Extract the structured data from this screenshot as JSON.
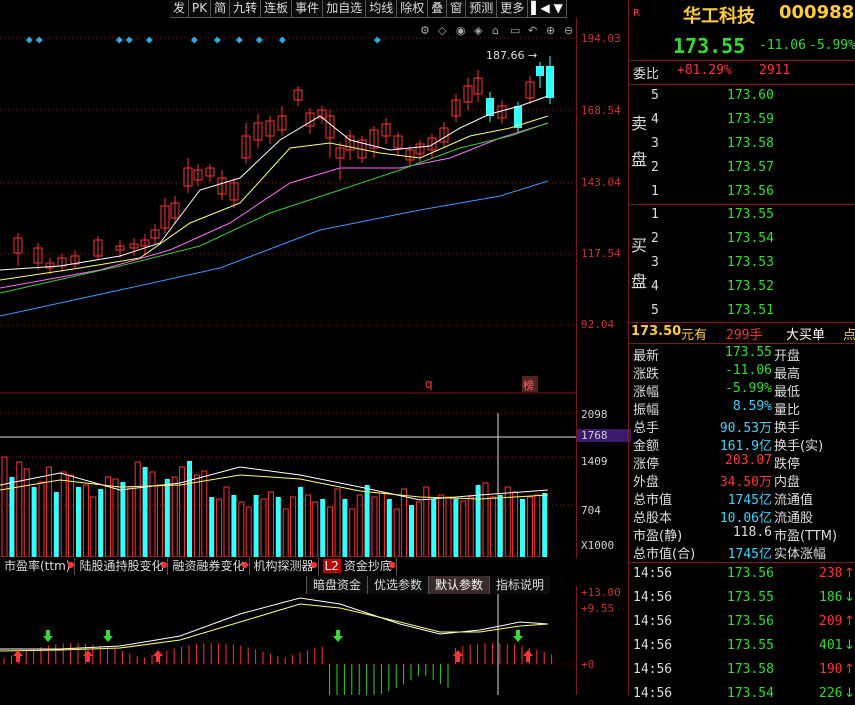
{
  "toolbar": [
    "发",
    "PK",
    "简",
    "九转",
    "连板",
    "事件",
    "加自选",
    "均线",
    "除权",
    "叠",
    "窗",
    "预测",
    "更多"
  ],
  "main_axis": [
    "194.03",
    "168.54",
    "143.04",
    "117.54",
    "92.04"
  ],
  "vol_axis": [
    "2098",
    "1768",
    "1409",
    "704",
    "X1000"
  ],
  "macd_axis": [
    "+13.00",
    "+9.55",
    "+0"
  ],
  "peak_label": "187.66",
  "bottom_marks": {
    "q": "q",
    "bang": "榜"
  },
  "indicator_tabs": [
    "市盈率(ttm)",
    "陆股通持股变化",
    "融资融券变化",
    "机构探测器",
    "资金抄底"
  ],
  "l2_badge": "L2",
  "sub_tabs": [
    "暗盘资金",
    "优选参数",
    "默认参数",
    "指标说明"
  ],
  "stock": {
    "badge": "R",
    "name": "华工科技",
    "code": "000988",
    "price": "173.55",
    "change": "-11.06",
    "pct": "-5.99%"
  },
  "weibi": {
    "label": "委比",
    "pct": "+81.29%",
    "diff": "2911"
  },
  "sell": {
    "label1": "卖",
    "label2": "盘",
    "levels": [
      {
        "n": "5",
        "p": "173.60"
      },
      {
        "n": "4",
        "p": "173.59"
      },
      {
        "n": "3",
        "p": "173.58"
      },
      {
        "n": "2",
        "p": "173.57"
      },
      {
        "n": "1",
        "p": "173.56"
      }
    ]
  },
  "buy": {
    "label1": "买",
    "label2": "盘",
    "levels": [
      {
        "n": "1",
        "p": "173.55"
      },
      {
        "n": "2",
        "p": "173.54"
      },
      {
        "n": "3",
        "p": "173.53"
      },
      {
        "n": "4",
        "p": "173.52"
      },
      {
        "n": "5",
        "p": "173.51"
      }
    ]
  },
  "bigorder": {
    "price": "173.50",
    "text1": "元有",
    "qty": "299手",
    "text2": "大买单",
    "tail": "点"
  },
  "stats": [
    {
      "l": "最新",
      "v": "173.55",
      "c": "gval",
      "l2": "开盘"
    },
    {
      "l": "涨跌",
      "v": "-11.06",
      "c": "gval",
      "l2": "最高"
    },
    {
      "l": "涨幅",
      "v": "-5.99%",
      "c": "gval",
      "l2": "最低"
    },
    {
      "l": "振幅",
      "v": "8.59%",
      "c": "cyan",
      "l2": "量比"
    },
    {
      "l": "总手",
      "v": "90.53万",
      "c": "cyan",
      "l2": "换手"
    },
    {
      "l": "金额",
      "v": "161.9亿",
      "c": "cyan",
      "l2": "换手(实)"
    },
    {
      "l": "涨停",
      "v": "203.07",
      "c": "rval",
      "l2": "跌停"
    },
    {
      "l": "外盘",
      "v": "34.50万",
      "c": "rval",
      "l2": "内盘"
    },
    {
      "l": "总市值",
      "v": "1745亿",
      "c": "cyan",
      "l2": "流通值"
    },
    {
      "l": "总股本",
      "v": "10.06亿",
      "c": "cyan",
      "l2": "流通股"
    },
    {
      "l": "市盈(静)",
      "v": "118.6",
      "c": "wval",
      "l2": "市盈(TTM)"
    },
    {
      "l": "总市值(合)",
      "v": "1745亿",
      "c": "cyan",
      "l2": "实体涨幅"
    }
  ],
  "ticks": [
    {
      "t": "14:56",
      "p": "173.56",
      "q": "238",
      "dir": "up"
    },
    {
      "t": "14:56",
      "p": "173.55",
      "q": "186",
      "dir": "down"
    },
    {
      "t": "14:56",
      "p": "173.56",
      "q": "209",
      "dir": "up"
    },
    {
      "t": "14:56",
      "p": "173.55",
      "q": "401",
      "dir": "down"
    },
    {
      "t": "14:56",
      "p": "173.58",
      "q": "190",
      "dir": "up"
    },
    {
      "t": "14:56",
      "p": "173.54",
      "q": "226",
      "dir": "down"
    }
  ],
  "colors": {
    "up": "#ff3333",
    "down": "#33ffff",
    "ma5": "#ffffff",
    "ma10": "#ffff66",
    "ma20": "#ff66ff",
    "ma30": "#33cc33",
    "ma60": "#3399ff",
    "grid": "#7a1a1a"
  }
}
